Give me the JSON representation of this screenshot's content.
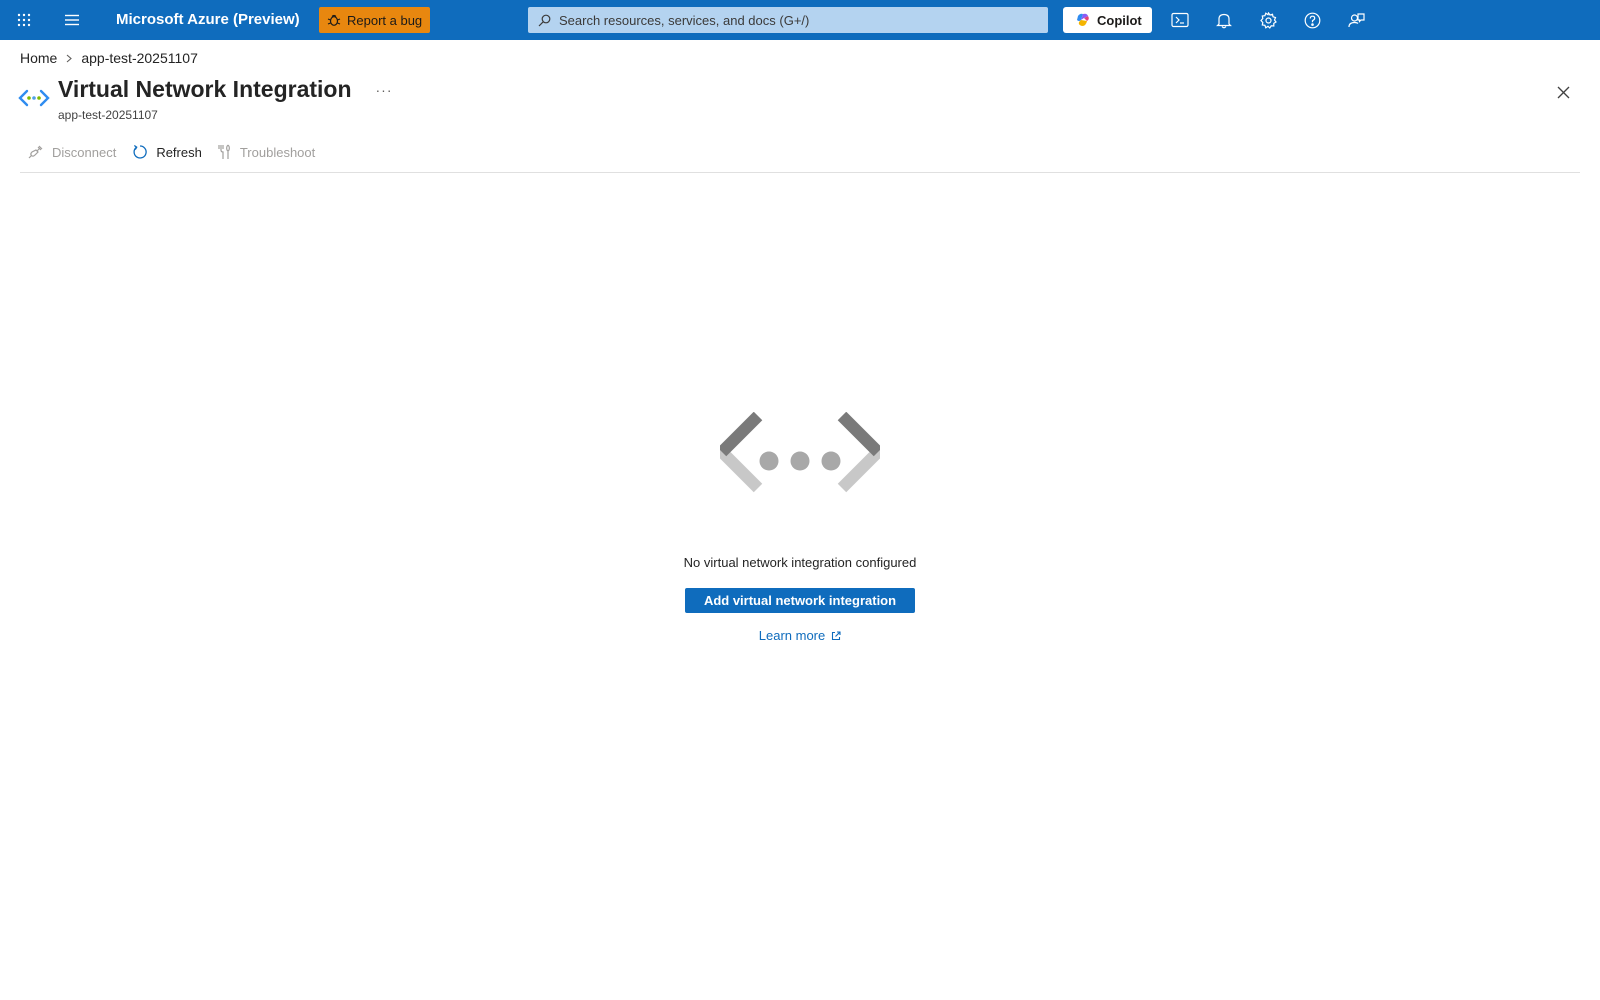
{
  "topbar": {
    "brand": "Microsoft Azure (Preview)",
    "report_bug_label": "Report a bug",
    "search_placeholder": "Search resources, services, and docs (G+/)",
    "copilot_label": "Copilot",
    "icons": [
      "app-launcher-icon",
      "hamburger-menu-icon",
      "bug-icon",
      "search-icon",
      "copilot-icon",
      "cloud-shell-icon",
      "bell-icon",
      "gear-icon",
      "help-icon",
      "feedback-icon"
    ],
    "colors": {
      "bar": "#0f6cbd",
      "bug_button": "#e8870f",
      "search_bg": "#b4d3f0"
    }
  },
  "breadcrumb": {
    "items": [
      "Home",
      "app-test-20251107"
    ]
  },
  "header": {
    "title": "Virtual Network Integration",
    "subtitle": "app-test-20251107",
    "more_label": "···"
  },
  "toolbar": {
    "disconnect_label": "Disconnect",
    "refresh_label": "Refresh",
    "troubleshoot_label": "Troubleshoot"
  },
  "empty_state": {
    "message": "No virtual network integration configured",
    "action_label": "Add virtual network integration",
    "learn_more_label": "Learn more"
  }
}
